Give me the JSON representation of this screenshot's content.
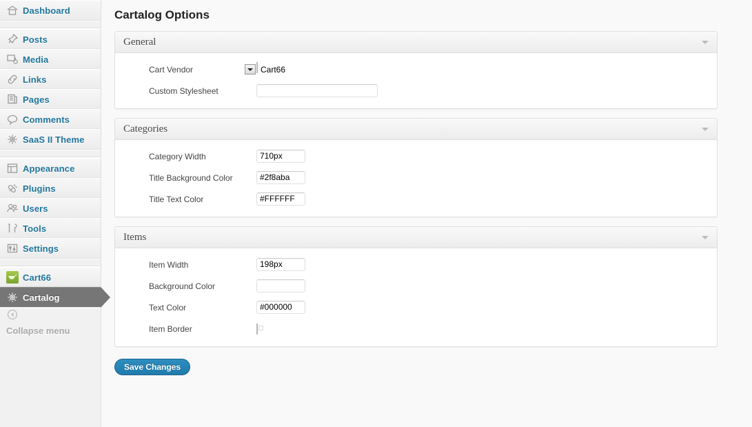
{
  "sidebar": {
    "groups": [
      {
        "items": [
          {
            "label": "Dashboard",
            "icon": "dashboard-home-icon",
            "current": false
          }
        ]
      },
      {
        "items": [
          {
            "label": "Posts",
            "icon": "pin-icon",
            "current": false
          },
          {
            "label": "Media",
            "icon": "media-icon",
            "current": false
          },
          {
            "label": "Links",
            "icon": "link-icon",
            "current": false
          },
          {
            "label": "Pages",
            "icon": "pages-icon",
            "current": false
          },
          {
            "label": "Comments",
            "icon": "comment-bubble-icon",
            "current": false
          },
          {
            "label": "SaaS II Theme",
            "icon": "gear-icon",
            "current": false
          }
        ]
      },
      {
        "items": [
          {
            "label": "Appearance",
            "icon": "appearance-icon",
            "current": false
          },
          {
            "label": "Plugins",
            "icon": "plug-icon",
            "current": false
          },
          {
            "label": "Users",
            "icon": "users-icon",
            "current": false
          },
          {
            "label": "Tools",
            "icon": "tools-icon",
            "current": false
          },
          {
            "label": "Settings",
            "icon": "settings-sliders-icon",
            "current": false
          }
        ]
      },
      {
        "items": [
          {
            "label": "Cart66",
            "icon": "cart66-icon",
            "current": false
          },
          {
            "label": "Cartalog",
            "icon": "gear-icon",
            "current": true
          }
        ]
      }
    ],
    "collapse": {
      "label": "Collapse menu",
      "icon": "collapse-left-arrow-icon"
    }
  },
  "page": {
    "title": "Cartalog Options"
  },
  "panels": [
    {
      "title": "General",
      "toggle_icon": "chevron-down-icon",
      "fields": [
        {
          "label": "Cart Vendor",
          "type": "select",
          "value": "Cart66",
          "options": [
            "Cart66"
          ],
          "name": "cart-vendor-select"
        },
        {
          "label": "Custom Stylesheet",
          "type": "text-wide",
          "value": "",
          "placeholder": "",
          "name": "custom-stylesheet-input"
        }
      ]
    },
    {
      "title": "Categories",
      "toggle_icon": "chevron-down-icon",
      "fields": [
        {
          "label": "Category Width",
          "type": "text",
          "value": "710px",
          "placeholder": "",
          "name": "category-width-input"
        },
        {
          "label": "Title Background Color",
          "type": "text",
          "value": "#2f8aba",
          "placeholder": "",
          "name": "title-background-color-input"
        },
        {
          "label": "Title Text Color",
          "type": "text",
          "value": "#FFFFFF",
          "placeholder": "",
          "name": "title-text-color-input"
        }
      ]
    },
    {
      "title": "Items",
      "toggle_icon": "chevron-down-icon",
      "fields": [
        {
          "label": "Item Width",
          "type": "text",
          "value": "198px",
          "placeholder": "",
          "name": "item-width-input"
        },
        {
          "label": "Background Color",
          "type": "text",
          "value": "",
          "placeholder": "",
          "name": "item-background-color-input"
        },
        {
          "label": "Text Color",
          "type": "text",
          "value": "#000000",
          "placeholder": "",
          "name": "item-text-color-input"
        },
        {
          "label": "Item Border",
          "type": "checkbox",
          "checked": false,
          "name": "item-border-checkbox"
        }
      ]
    }
  ],
  "actions": {
    "save_label": "Save Changes"
  },
  "colors": {
    "accent": "#21759b",
    "button": "#2e8ec0",
    "active_menu": "#767676",
    "sidebar_bg": "#f1f1f1",
    "content_bg": "#f9f9f9"
  }
}
